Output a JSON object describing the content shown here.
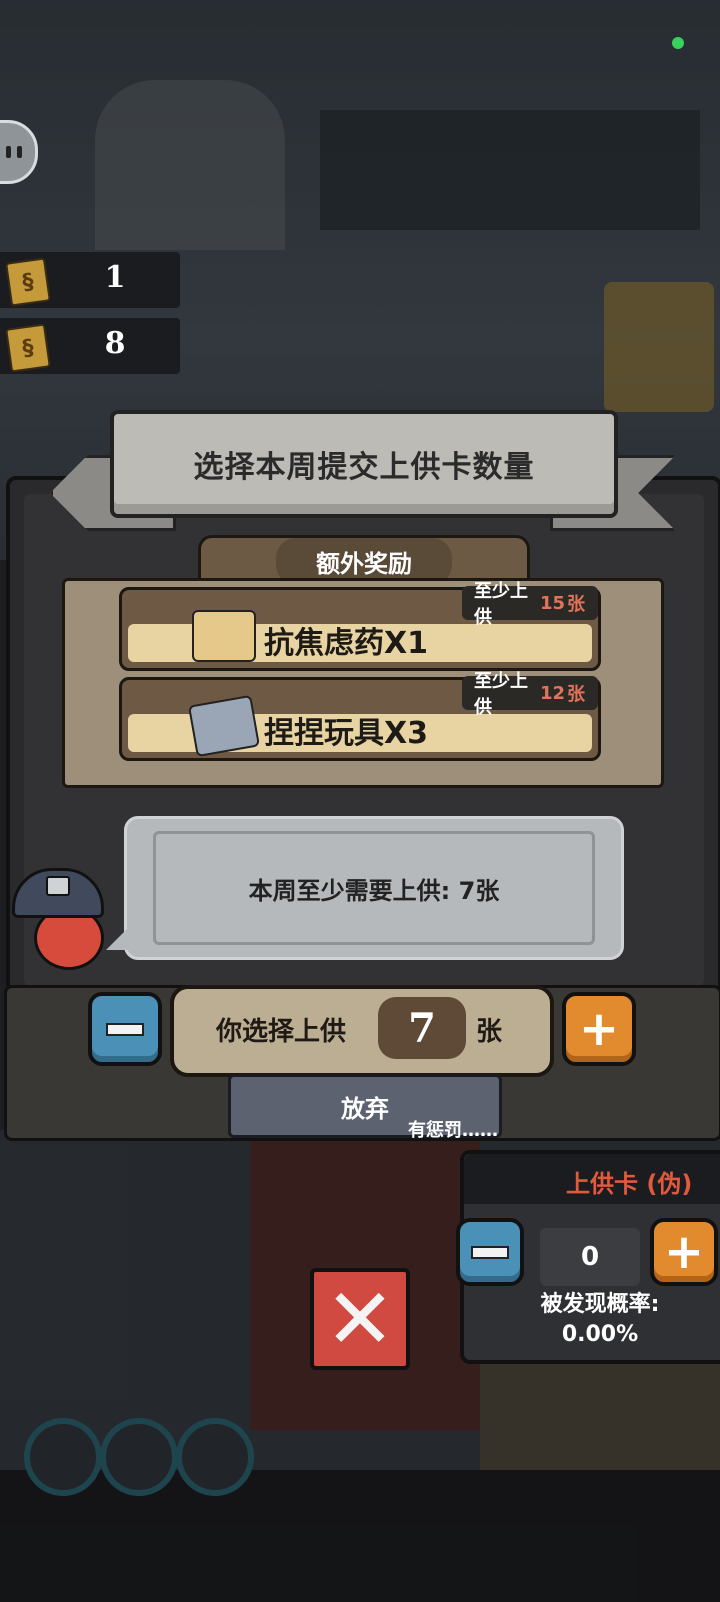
{
  "resources": [
    {
      "icon": "card-icon",
      "count": "1"
    },
    {
      "icon": "card-icon",
      "count": "8"
    }
  ],
  "dialog": {
    "title": "选择本周提交上供卡数量",
    "rewards_tab": "额外奖励",
    "rewards": [
      {
        "name": "抗焦虑药X1",
        "requirement_prefix": "至少上供",
        "requirement_num": "15",
        "requirement_suffix": "张",
        "icon": "pill-pack-icon"
      },
      {
        "name": "捏捏玩具X3",
        "requirement_prefix": "至少上供",
        "requirement_num": "12",
        "requirement_suffix": "张",
        "icon": "squishy-toy-icon"
      }
    ],
    "speech": "本周至少需要上供: 7张",
    "select_prefix": "你选择上供",
    "select_value": "7",
    "select_suffix": "张",
    "minus_symbol": "−",
    "plus_symbol": "+",
    "give_up": "放弃",
    "penalty": "有惩罚……"
  },
  "fake_card": {
    "title": "上供卡 (伪)",
    "value": "0",
    "probability_label": "被发现概率:",
    "probability_value": "0.00%"
  },
  "close_symbol": "✕",
  "colors": {
    "accent_orange": "#e28a2e",
    "accent_blue": "#4b90b7",
    "danger_red": "#d04a42",
    "highlight_text": "#e0735a"
  }
}
